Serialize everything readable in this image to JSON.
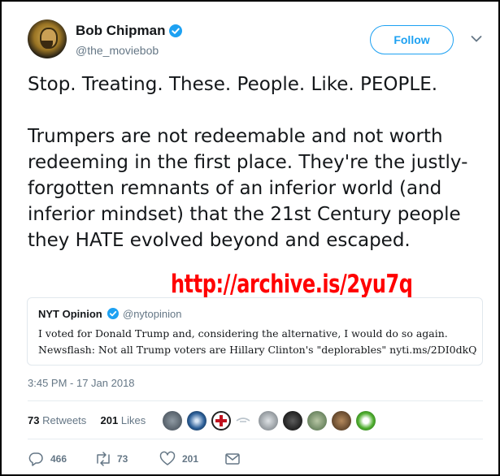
{
  "author": {
    "display_name": "Bob Chipman",
    "handle": "@the_moviebob",
    "verified": true
  },
  "follow_button": {
    "label": "Follow"
  },
  "tweet": {
    "text": "Stop. Treating. These. People. Like. PEOPLE.\n\nTrumpers are not redeemable and not worth redeeming in the first place. They're the justly-forgotten remnants of an inferior world (and inferior mindset) that the 21st Century people they HATE evolved beyond and escaped.",
    "timestamp": "3:45 PM - 17 Jan 2018"
  },
  "watermark": {
    "text": "http://archive.is/2yu7q",
    "color": "#ff0000"
  },
  "quoted_tweet": {
    "name": "NYT Opinion",
    "handle": "@nytopinion",
    "text_line1": "I voted for Donald Trump and, considering the alternative, I would do so again.",
    "text_line2": "Newsflash: Not all Trump voters are Hillary Clinton's \"deplorables\" nyti.ms/2DI0dkQ"
  },
  "stats": {
    "retweets_count": "73",
    "retweets_label": "Retweets",
    "likes_count": "201",
    "likes_label": "Likes"
  },
  "actions": {
    "replies": "466",
    "retweets": "73",
    "likes": "201"
  },
  "colors": {
    "accent": "#1da1f2",
    "secondary_text": "#657786",
    "border": "#e1e8ed"
  }
}
